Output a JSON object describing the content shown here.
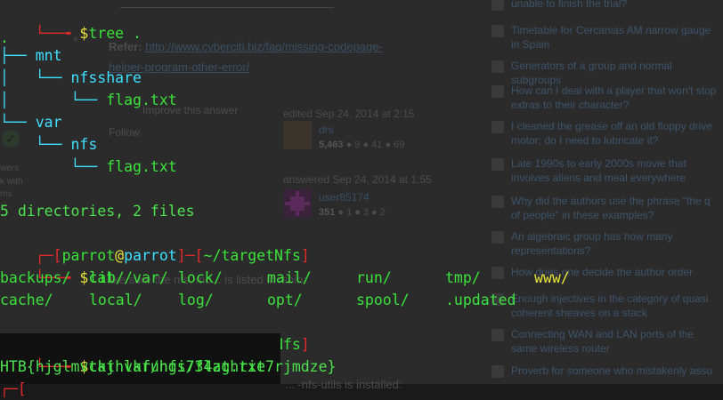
{
  "background_page": {
    "refer_label": "Refer:",
    "refer_link": "http://www.cyberciti.biz/faq/missing-codepage-",
    "refer_link_2": "helper-program-other-error/",
    "improve_answer": "Improve this answer",
    "follow": "Follow",
    "edited": "edited Sep 24, 2014 at 2:15",
    "editor_name": "drs",
    "editor_rep": "5,463",
    "editor_badges": "● 9 ● 41 ● 69",
    "answered": "answered Sep 24, 2014 at 1:55",
    "answerer_name": "user85174",
    "answerer_rep": "351",
    "answerer_badges": "● 1 ● 3 ● 2",
    "left_fragment_1": "wers",
    "left_fragment_2": "k with",
    "left_fragment_3": "ms",
    "mid_text": "ake sure the nfs, mo... is listed in /sbin:",
    "mid_bottom": "... -nfs-utils is installed:"
  },
  "hot_questions": [
    {
      "title": "unable to finish the trial?"
    },
    {
      "title": "Timetable for Cercanias AM narrow gauge in Spain"
    },
    {
      "title": "Generators of a group and normal subgroups"
    },
    {
      "title": "How can I deal with a player that won't stop extras to their character?"
    },
    {
      "title": "I cleaned the grease off an old floppy drive motor; do I need to lubricate it?"
    },
    {
      "title": "Late 1990s to early 2000s movie that involves aliens and meal everywhere"
    },
    {
      "title": "Why did the authors use the phrase \"the q of people\" in these examples?"
    },
    {
      "title": "An algebraic group has how many representations?"
    },
    {
      "title": "How does one decide the author order"
    },
    {
      "title": "Enough injectives in the category of quasi coherent sheaves on a stack"
    },
    {
      "title": "Connecting WAN and LAN ports of the same wireless router"
    },
    {
      "title": "Proverb for someone who mistakenly assu"
    }
  ],
  "terminal": {
    "tree_cmd_dollar": "$",
    "tree_cmd": "tree .",
    "root": ".",
    "mnt": "mnt",
    "nfsshare": "nfsshare",
    "flag1": "flag.txt",
    "var": "var",
    "nfs": "nfs",
    "flag2": "flag.txt",
    "summary": "5 directories, 2 files",
    "prompt1": {
      "user": "parrot",
      "at": "@",
      "host": "parrot",
      "path": "~/targetNfs"
    },
    "cmd1": "cat /var/",
    "ls_items": [
      {
        "text": "backups/",
        "col": 0,
        "row": 0,
        "warn": false
      },
      {
        "text": "lib/",
        "col": 1,
        "row": 0,
        "warn": false
      },
      {
        "text": "lock/",
        "col": 2,
        "row": 0,
        "warn": false
      },
      {
        "text": "mail/",
        "col": 3,
        "row": 0,
        "warn": false
      },
      {
        "text": "run/",
        "col": 4,
        "row": 0,
        "warn": false
      },
      {
        "text": "tmp/",
        "col": 5,
        "row": 0,
        "warn": false
      },
      {
        "text": "www/",
        "col": 6,
        "row": 0,
        "warn": true
      },
      {
        "text": "cache/",
        "col": 0,
        "row": 1,
        "warn": false
      },
      {
        "text": "local/",
        "col": 1,
        "row": 1,
        "warn": false
      },
      {
        "text": "log/",
        "col": 2,
        "row": 1,
        "warn": false
      },
      {
        "text": "opt/",
        "col": 3,
        "row": 1,
        "warn": false
      },
      {
        "text": "spool/",
        "col": 4,
        "row": 1,
        "warn": false
      },
      {
        "text": ".updated",
        "col": 5,
        "row": 1,
        "warn": false
      }
    ],
    "prompt2": {
      "user": "parrot",
      "at": "@",
      "host": "parrot",
      "path": "~/targetNfs"
    },
    "cmd2": "cat var/nfs/flag.txt",
    "flag_output": "HTB{hjglmvtkjhlkfuhgi734zthrie7rjmdze}"
  },
  "colors": {
    "terminal_green": "#3be23b",
    "terminal_cyan": "#3fe0ff",
    "terminal_red": "#e12b2b",
    "terminal_yellow": "#e8e33a"
  }
}
